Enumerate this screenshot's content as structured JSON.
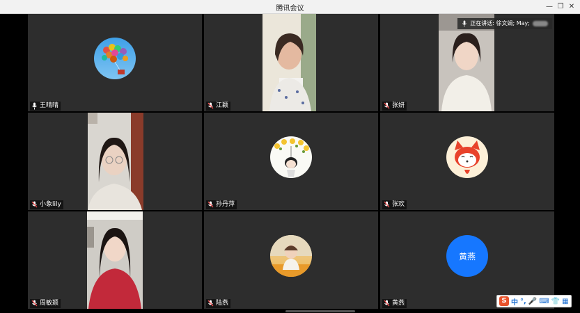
{
  "window": {
    "title": "腾讯会议",
    "controls": [
      "minimize-icon",
      "restore-icon",
      "close-icon"
    ]
  },
  "speaking": {
    "label": "正在讲话: 徐文娟; May;"
  },
  "participants": [
    {
      "name": "王晴晴",
      "mic": "mic-on",
      "view": "avatar-balloons"
    },
    {
      "name": "江颖",
      "mic": "mic-muted",
      "view": "video"
    },
    {
      "name": "张妍",
      "mic": "mic-muted",
      "view": "video"
    },
    {
      "name": "小象lily",
      "mic": "mic-muted",
      "view": "video"
    },
    {
      "name": "孙丹萍",
      "mic": "mic-muted",
      "view": "avatar-flowers"
    },
    {
      "name": "张欢",
      "mic": "mic-muted",
      "view": "avatar-fox"
    },
    {
      "name": "周敏颖",
      "mic": "mic-muted",
      "view": "video"
    },
    {
      "name": "陆燕",
      "mic": "mic-muted",
      "view": "avatar-photo"
    },
    {
      "name": "黄燕",
      "mic": "mic-muted",
      "view": "avatar-text",
      "avatar_text": "黄燕"
    }
  ],
  "ime_toolbar": {
    "logo": "S",
    "mode": "中",
    "items": [
      "punctuation-icon",
      "voice-icon",
      "keyboard-icon",
      "skin-icon",
      "toolbox-icon"
    ]
  },
  "colors": {
    "tile_bg": "#2d2d2d",
    "avatar_blue": "#1677ff",
    "ime_logo": "#e8532c"
  }
}
